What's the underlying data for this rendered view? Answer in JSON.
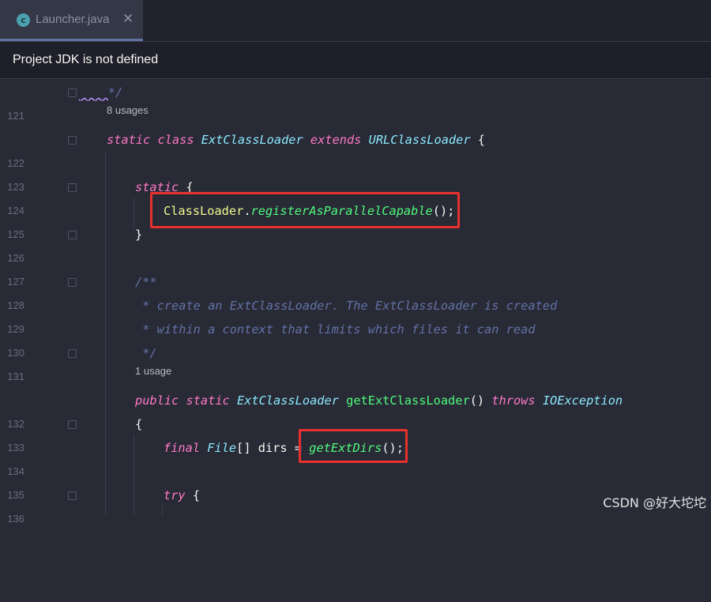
{
  "tab": {
    "icon_letter": "c",
    "label": "Launcher.java",
    "close": "✕"
  },
  "banner": {
    "text": "Project JDK is not defined"
  },
  "hints": {
    "h1": "8 usages",
    "h2": "1 usage"
  },
  "lines": {
    "n121": "121",
    "n122": "122",
    "n123": "123",
    "n124": "124",
    "n125": "125",
    "n126": "126",
    "n127": "127",
    "n128": "128",
    "n129": "129",
    "n130": "130",
    "n131": "131",
    "n132": "132",
    "n133": "133",
    "n134": "134",
    "n135": "135",
    "n136": "136"
  },
  "code": {
    "l121": "*/",
    "l122_kw1": "static",
    "l122_kw2": "class",
    "l122_name": "ExtClassLoader",
    "l122_kw3": "extends",
    "l122_super": "URLClassLoader",
    "l122_brace": " {",
    "l124_kw": "static",
    "l124_brace": " {",
    "l125_cls": "ClassLoader",
    "l125_dot": ".",
    "l125_method": "registerAsParallelCapable",
    "l125_tail": "();",
    "l126": "}",
    "l128": "/**",
    "l129": " * create an ExtClassLoader. The ExtClassLoader is created",
    "l130": " * within a context that limits which files it can read",
    "l131": " */",
    "l132_kw1": "public",
    "l132_kw2": "static",
    "l132_type": "ExtClassLoader",
    "l132_method": "getExtClassLoader",
    "l132_parens": "()",
    "l132_kw3": "throws",
    "l132_exc": "IOException",
    "l133": "{",
    "l134_kw": "final",
    "l134_type": "File",
    "l134_rest": "[] dirs = ",
    "l134_method": "getExtDirs",
    "l134_tail": "();",
    "l136_kw": "try",
    "l136_brace": " {"
  },
  "watermark": "CSDN @好大坨坨",
  "colors": {
    "background": "#282a36",
    "keyword": "#ff79c6",
    "type": "#8be9fd",
    "class": "#f1fa8c",
    "method": "#50fa7b",
    "comment": "#6272a4",
    "highlight_box": "#e8312d"
  }
}
